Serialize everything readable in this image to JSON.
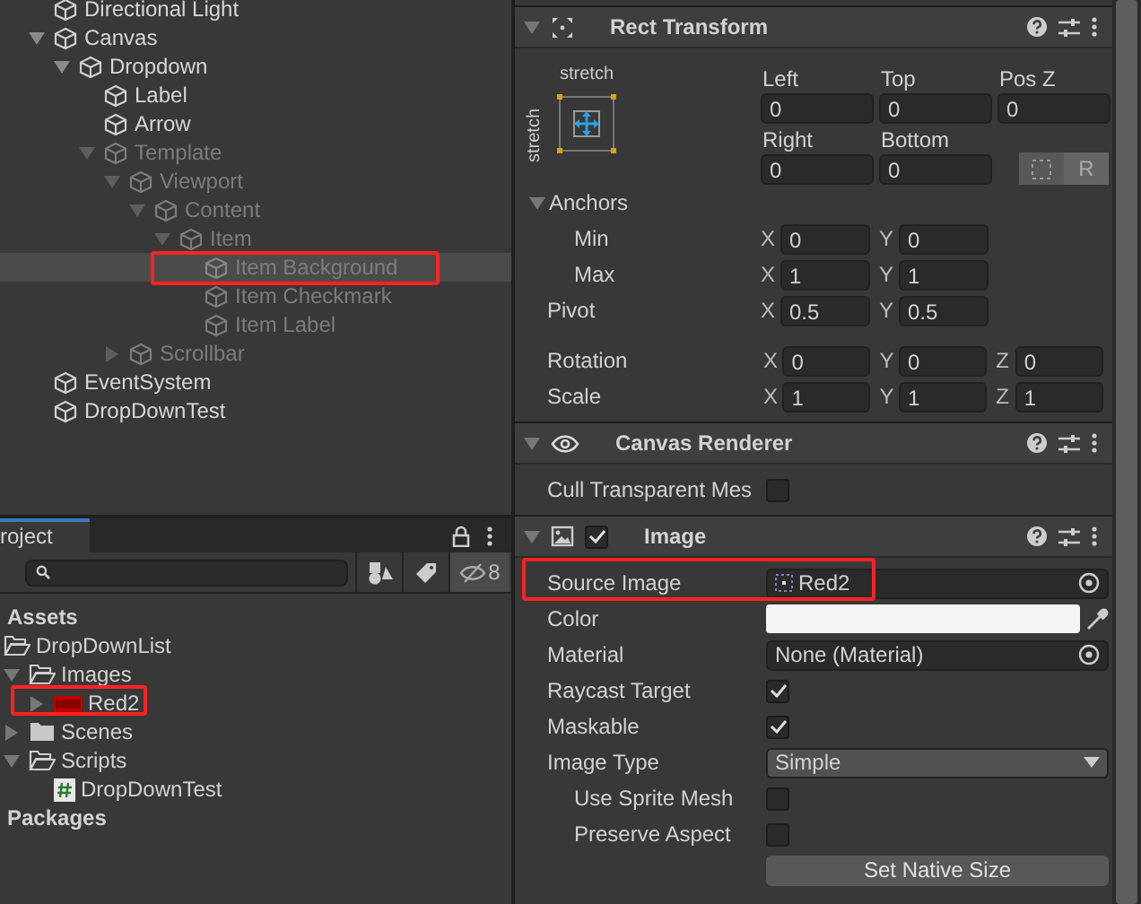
{
  "hierarchy": {
    "items": [
      {
        "name": "Directional Light",
        "inactive": false,
        "selected": false
      },
      {
        "name": "Canvas",
        "inactive": false,
        "selected": false,
        "expanded": true,
        "children": [
          {
            "name": "Dropdown",
            "inactive": false,
            "selected": false,
            "expanded": true,
            "children": [
              {
                "name": "Label",
                "inactive": false,
                "selected": false
              },
              {
                "name": "Arrow",
                "inactive": false,
                "selected": false
              },
              {
                "name": "Template",
                "inactive": true,
                "selected": false,
                "expanded": true,
                "children": [
                  {
                    "name": "Viewport",
                    "inactive": true,
                    "selected": false,
                    "expanded": true,
                    "children": [
                      {
                        "name": "Content",
                        "inactive": true,
                        "selected": false,
                        "expanded": true,
                        "children": [
                          {
                            "name": "Item",
                            "inactive": true,
                            "selected": false,
                            "expanded": true,
                            "children": [
                              {
                                "name": "Item Background",
                                "inactive": true,
                                "selected": true
                              },
                              {
                                "name": "Item Checkmark",
                                "inactive": true,
                                "selected": false
                              },
                              {
                                "name": "Item Label",
                                "inactive": true,
                                "selected": false
                              }
                            ]
                          }
                        ]
                      }
                    ]
                  },
                  {
                    "name": "Scrollbar",
                    "inactive": true,
                    "selected": false,
                    "expanded": false
                  }
                ]
              }
            ]
          }
        ]
      },
      {
        "name": "EventSystem",
        "inactive": false,
        "selected": false
      },
      {
        "name": "DropDownTest",
        "inactive": false,
        "selected": false
      }
    ]
  },
  "project": {
    "tab": "roject",
    "filter_count": "8",
    "tree": [
      {
        "name": "Assets",
        "kind": "root",
        "children": [
          {
            "name": "DropDownList",
            "kind": "folder",
            "children": [
              {
                "name": "Images",
                "kind": "folder",
                "expanded": true,
                "children": [
                  {
                    "name": "Red2",
                    "kind": "sprite",
                    "expanded": false
                  }
                ]
              },
              {
                "name": "Scenes",
                "kind": "folder",
                "expanded": false
              },
              {
                "name": "Scripts",
                "kind": "folder",
                "expanded": true,
                "children": [
                  {
                    "name": "DropDownTest",
                    "kind": "script"
                  }
                ]
              }
            ]
          }
        ]
      },
      {
        "name": "Packages",
        "kind": "root"
      }
    ]
  },
  "inspector": {
    "components": [
      {
        "kind": "rect_transform",
        "title": "Rect Transform",
        "expanded": true,
        "preset": {
          "horizontal": "stretch",
          "vertical": "stretch"
        },
        "offsets": [
          {
            "label": "Left",
            "value": "0"
          },
          {
            "label": "Top",
            "value": "0"
          },
          {
            "label": "Pos Z",
            "value": "0"
          },
          {
            "label": "Right",
            "value": "0"
          },
          {
            "label": "Bottom",
            "value": "0"
          }
        ],
        "raw_button": "R",
        "anchors": {
          "label": "Anchors",
          "expanded": true,
          "rows": [
            {
              "label": "Min",
              "fields": [
                {
                  "axis": "X",
                  "value": "0"
                },
                {
                  "axis": "Y",
                  "value": "0"
                }
              ]
            },
            {
              "label": "Max",
              "fields": [
                {
                  "axis": "X",
                  "value": "1"
                },
                {
                  "axis": "Y",
                  "value": "1"
                }
              ]
            }
          ]
        },
        "pivot": {
          "label": "Pivot",
          "fields": [
            {
              "axis": "X",
              "value": "0.5"
            },
            {
              "axis": "Y",
              "value": "0.5"
            }
          ]
        },
        "vectors": [
          {
            "label": "Rotation",
            "fields": [
              {
                "axis": "X",
                "value": "0"
              },
              {
                "axis": "Y",
                "value": "0"
              },
              {
                "axis": "Z",
                "value": "0"
              }
            ]
          },
          {
            "label": "Scale",
            "fields": [
              {
                "axis": "X",
                "value": "1"
              },
              {
                "axis": "Y",
                "value": "1"
              },
              {
                "axis": "Z",
                "value": "1"
              }
            ]
          }
        ]
      },
      {
        "kind": "canvas_renderer",
        "title": "Canvas Renderer",
        "expanded": true,
        "properties": [
          {
            "kind": "checkbox",
            "label": "Cull Transparent Mes",
            "checked": false
          }
        ]
      },
      {
        "kind": "image",
        "title": "Image",
        "expanded": true,
        "enabled": true,
        "properties": [
          {
            "kind": "object",
            "label": "Source Image",
            "value": "Red2"
          },
          {
            "kind": "color",
            "label": "Color"
          },
          {
            "kind": "object",
            "label": "Material",
            "value": "None (Material)"
          },
          {
            "kind": "checkbox",
            "label": "Raycast Target",
            "checked": true
          },
          {
            "kind": "checkbox",
            "label": "Maskable",
            "checked": true
          },
          {
            "kind": "dropdown",
            "label": "Image Type",
            "value": "Simple"
          },
          {
            "kind": "checkbox",
            "label": "Use Sprite Mesh",
            "checked": false,
            "indented": true
          },
          {
            "kind": "checkbox",
            "label": "Preserve Aspect",
            "checked": false,
            "indented": true
          }
        ],
        "button": "Set Native Size"
      }
    ]
  }
}
